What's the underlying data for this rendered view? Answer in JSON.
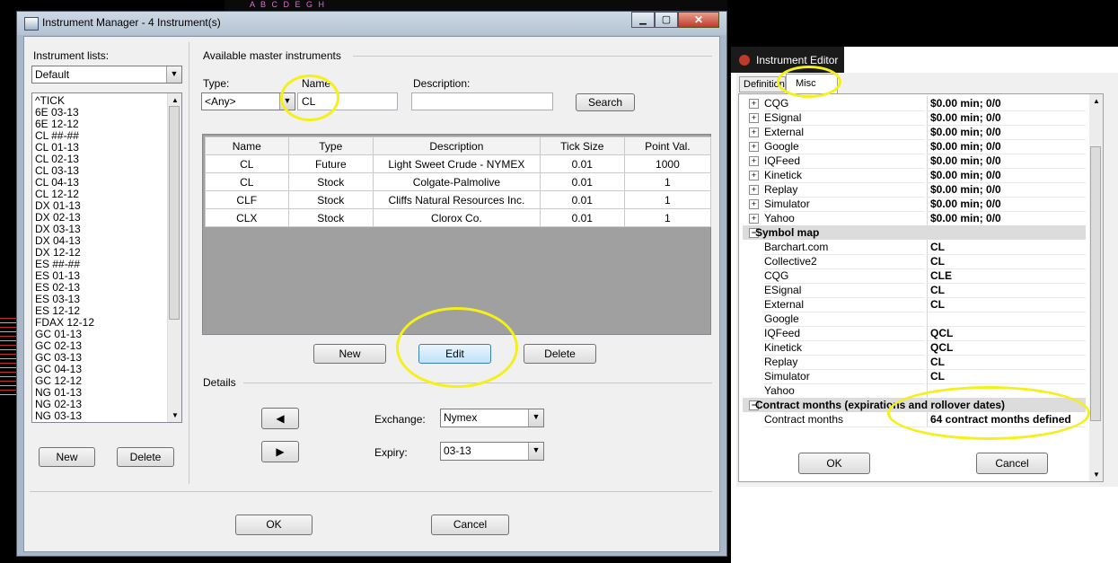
{
  "background_strip": {
    "text": "A B C D E G H"
  },
  "instrument_manager": {
    "title": "Instrument Manager - 4 Instrument(s)",
    "instrument_lists_label": "Instrument lists:",
    "list_selected": "Default",
    "list_items": [
      "^TICK",
      "6E 03-13",
      "6E 12-12",
      "CL ##-##",
      "CL 01-13",
      "CL 02-13",
      "CL 03-13",
      "CL 04-13",
      "CL 12-12",
      "DX 01-13",
      "DX 02-13",
      "DX 03-13",
      "DX 04-13",
      "DX 12-12",
      "ES ##-##",
      "ES 01-13",
      "ES 02-13",
      "ES 03-13",
      "ES 12-12",
      "FDAX 12-12",
      "GC 01-13",
      "GC 02-13",
      "GC 03-13",
      "GC 04-13",
      "GC 12-12",
      "NG 01-13",
      "NG 02-13",
      "NG 03-13"
    ],
    "list_new_label": "New",
    "list_delete_label": "Delete",
    "available_label": "Available master instruments",
    "type_label": "Type:",
    "type_value": "<Any>",
    "name_label": "Name",
    "name_value": "CL",
    "description_label": "Description:",
    "description_value": "",
    "search_label": "Search",
    "table": {
      "headers": [
        "Name",
        "Type",
        "Description",
        "Tick Size",
        "Point Val."
      ],
      "rows": [
        [
          "CL",
          "Future",
          "Light Sweet Crude - NYMEX",
          "0.01",
          "1000"
        ],
        [
          "CL",
          "Stock",
          "Colgate-Palmolive",
          "0.01",
          "1"
        ],
        [
          "CLF",
          "Stock",
          "Cliffs Natural Resources Inc.",
          "0.01",
          "1"
        ],
        [
          "CLX",
          "Stock",
          "Clorox Co.",
          "0.01",
          "1"
        ]
      ]
    },
    "new_label": "New",
    "edit_label": "Edit",
    "delete_label": "Delete",
    "details_label": "Details",
    "exchange_label": "Exchange:",
    "exchange_value": "Nymex",
    "expiry_label": "Expiry:",
    "expiry_value": "03-13",
    "ok_label": "OK",
    "cancel_label": "Cancel"
  },
  "instrument_editor": {
    "title": "Instrument Editor",
    "tabs": [
      "Definition",
      "Misc"
    ],
    "active_tab": "Misc",
    "provider_rows": [
      {
        "name": "CQG",
        "value": "$0.00 min;  0/0"
      },
      {
        "name": "ESignal",
        "value": "$0.00 min;  0/0"
      },
      {
        "name": "External",
        "value": "$0.00 min;  0/0"
      },
      {
        "name": "Google",
        "value": "$0.00 min;  0/0"
      },
      {
        "name": "IQFeed",
        "value": "$0.00 min;  0/0"
      },
      {
        "name": "Kinetick",
        "value": "$0.00 min;  0/0"
      },
      {
        "name": "Replay",
        "value": "$0.00 min;  0/0"
      },
      {
        "name": "Simulator",
        "value": "$0.00 min;  0/0"
      },
      {
        "name": "Yahoo",
        "value": "$0.00 min;  0/0"
      }
    ],
    "symbol_map_label": "Symbol map",
    "symbol_rows": [
      {
        "name": "Barchart.com",
        "value": "CL"
      },
      {
        "name": "Collective2",
        "value": "CL"
      },
      {
        "name": "CQG",
        "value": "CLE"
      },
      {
        "name": "ESignal",
        "value": "CL"
      },
      {
        "name": "External",
        "value": "CL"
      },
      {
        "name": "Google",
        "value": ""
      },
      {
        "name": "IQFeed",
        "value": "QCL"
      },
      {
        "name": "Kinetick",
        "value": "QCL"
      },
      {
        "name": "Replay",
        "value": "CL"
      },
      {
        "name": "Simulator",
        "value": "CL"
      },
      {
        "name": "Yahoo",
        "value": ""
      }
    ],
    "contract_months_category": "Contract months (expirations and rollover dates)",
    "contract_months_name": "Contract months",
    "contract_months_value": "64 contract months defined",
    "ok_label": "OK",
    "cancel_label": "Cancel"
  },
  "colors": {
    "highlight": "#f5ef1a",
    "window_frame": "#a9b8c8",
    "grid_empty": "#a0a0a0"
  }
}
